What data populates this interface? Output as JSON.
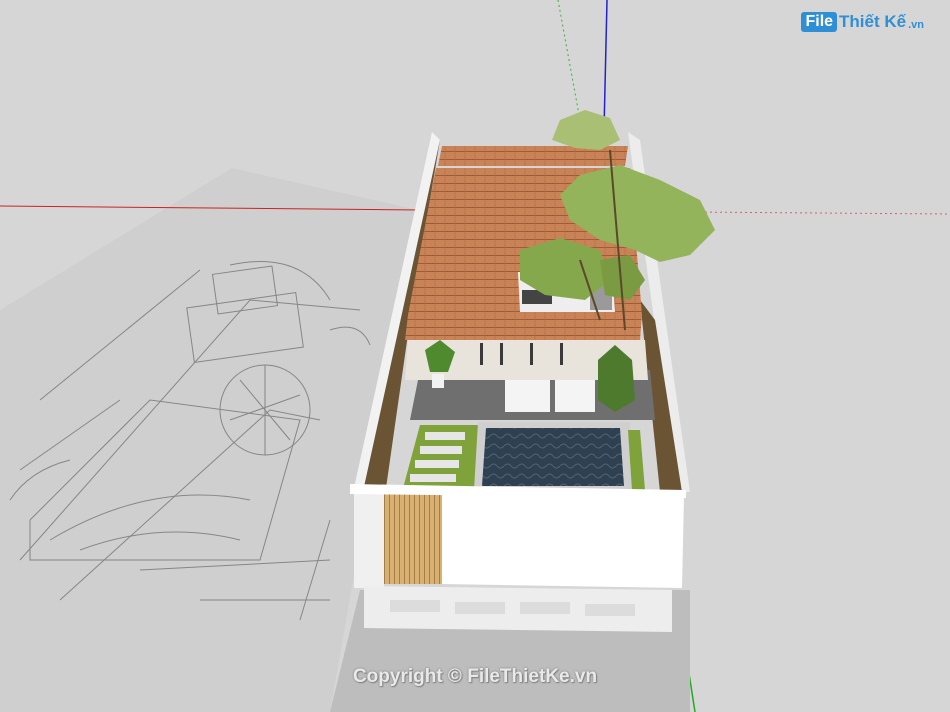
{
  "watermark": {
    "logo_file": "File",
    "logo_brand": "Thiết Kế",
    "logo_tld": ".vn",
    "copyright": "Copyright © FileThietKe.vn"
  },
  "colors": {
    "background": "#d6d6d6",
    "axis_red": "#cc2222",
    "axis_blue": "#2222cc",
    "axis_green": "#22aa22",
    "roof": "#c07a4e",
    "wall": "#ffffff",
    "pool": "#2e3e4c",
    "foliage": "#7fa23b",
    "wood": "#d2a867"
  }
}
